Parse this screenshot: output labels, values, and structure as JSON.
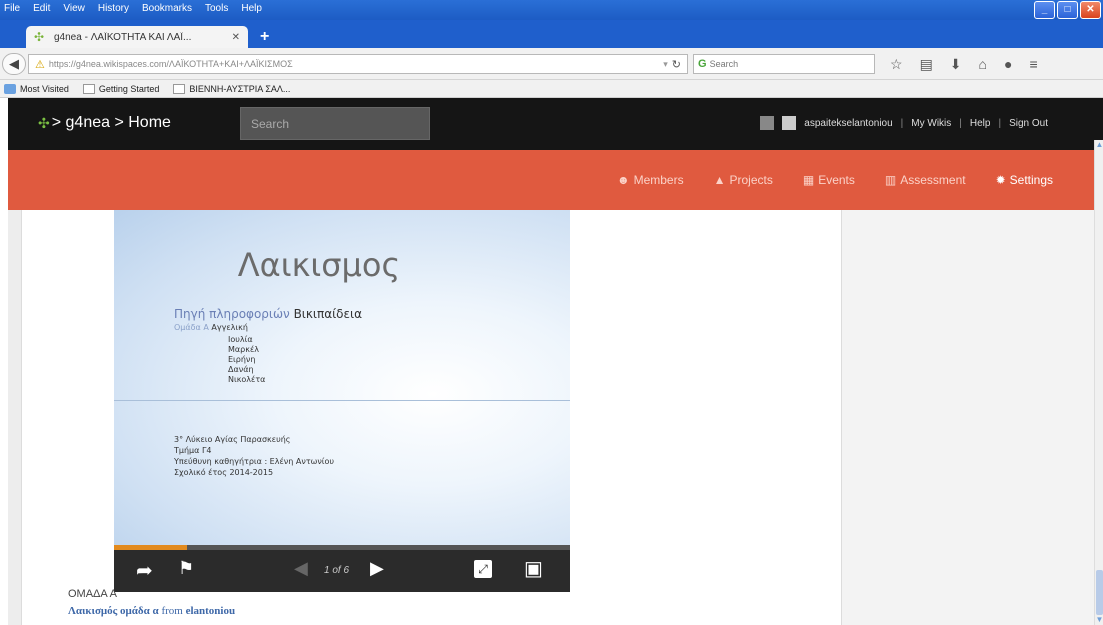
{
  "browser": {
    "menu": [
      "File",
      "Edit",
      "View",
      "History",
      "Bookmarks",
      "Tools",
      "Help"
    ],
    "tab_title": "g4nea - ΛΑΪΚΟΤΗΤΑ ΚΑΙ ΛΑΪ...",
    "url": "https://g4nea.wikispaces.com/ΛΑΪΚΟΤΗΤΑ+ΚΑΙ+ΛΑΪΚΙΣΜΟΣ",
    "search_placeholder": "Search",
    "bookmarks": [
      "Most Visited",
      "Getting Started",
      "ΒΙΕΝΝΗ-ΑΥΣΤΡΙΑ ΣΑΛ..."
    ]
  },
  "site": {
    "logo_text": "> g4nea > Home",
    "search_placeholder": "Search",
    "account": [
      "aspaitekselantoniou",
      "My Wikis",
      "Help",
      "Sign Out"
    ],
    "nav": [
      {
        "label": "Members",
        "icon": "members-icon"
      },
      {
        "label": "Projects",
        "icon": "projects-icon"
      },
      {
        "label": "Events",
        "icon": "events-icon"
      },
      {
        "label": "Assessment",
        "icon": "assessment-icon"
      },
      {
        "label": "Settings",
        "icon": "settings-icon"
      }
    ],
    "nav_accent": "#e05a3f"
  },
  "slide": {
    "title": "Λαικισμος",
    "source_prefix": "Πηγή πληροφοριών",
    "source_name": "Βικιπαίδεια",
    "group_prefix": "Ομάδα Α",
    "names": [
      "Αγγελική",
      "Ιουλία",
      "Μαρκέλ",
      "Ειρήνη",
      "Δανάη",
      "Νικολέτα"
    ],
    "info": [
      "3° Λύκειο Αγίας Παρασκευής",
      "Τμήμα Γ4",
      "Υπεύθυνη καθηγήτρια : Ελένη Αντωνίου",
      "Σχολικό έτος 2014-2015"
    ],
    "counter": "1 of 6",
    "progress": 0.16
  },
  "page": {
    "group_label": "ΟΜΑΔΑ Α",
    "embed_title": "Λαικισμός ομάδα α",
    "embed_from": " from ",
    "embed_author": "elantoniou"
  }
}
